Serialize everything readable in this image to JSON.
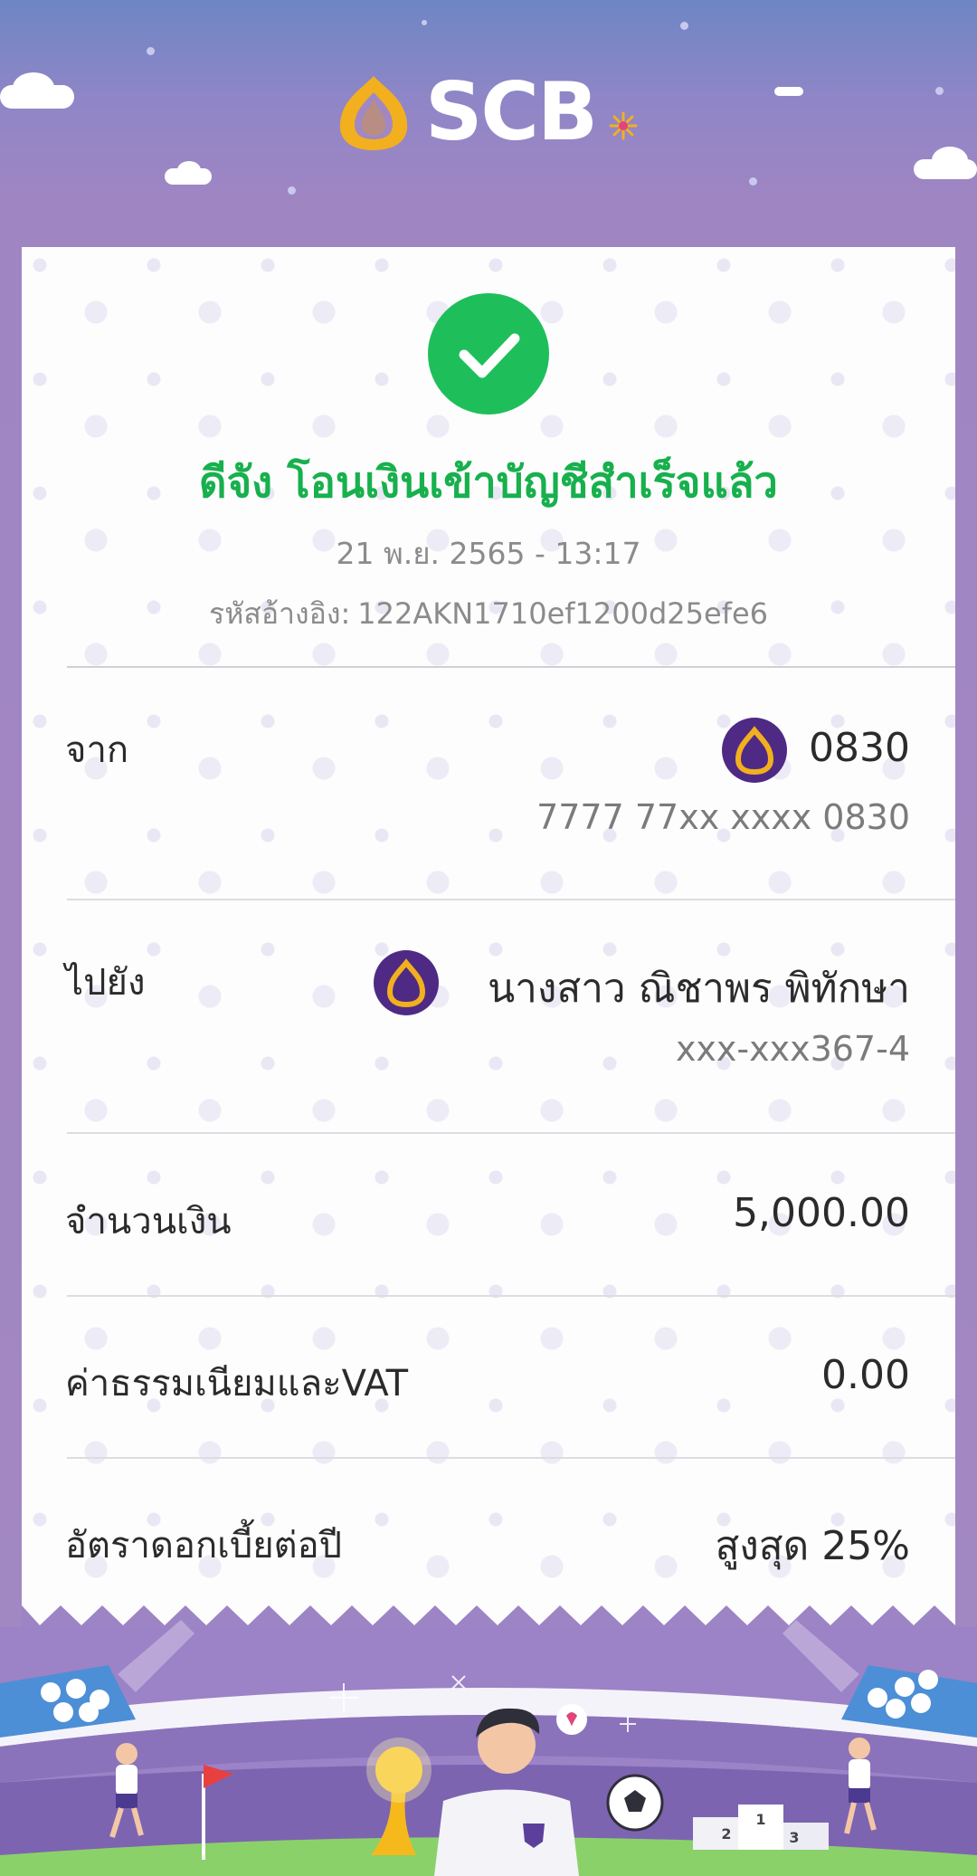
{
  "header": {
    "brand": "SCB",
    "logo_icon": "scb-lotus-icon",
    "colors": {
      "brand_gold": "#f2b01e",
      "brand_purple": "#4e2a84"
    }
  },
  "receipt": {
    "status_icon": "check-circle-icon",
    "status_color": "#1ebf5b",
    "title": "ดีจัง โอนเงินเข้าบัญชีสำเร็จแล้ว",
    "datetime": "21 พ.ย. 2565 - 13:17",
    "ref_label": "รหัสอ้างอิง:",
    "ref_value": "122AKN1710ef1200d25efe6",
    "from": {
      "label": "จาก",
      "account_short": "0830",
      "account_full": "7777 77xx xxxx 0830",
      "bank_icon": "scb-bank-icon"
    },
    "to": {
      "label": "ไปยัง",
      "name": "นางสาว ณิชาพร พิทักษา",
      "account": "xxx-xxx367-4",
      "bank_icon": "scb-bank-icon"
    },
    "amount": {
      "label": "จำนวนเงิน",
      "value": "5,000.00"
    },
    "fee": {
      "label": "ค่าธรรมเนียมและVAT",
      "value": "0.00"
    },
    "interest": {
      "label": "อัตราดอกเบี้ยต่อปี",
      "value": "สูงสุด 25%"
    }
  },
  "footer": {
    "illustration": "football-world-cup-banner",
    "podium_numbers": [
      "2",
      "1",
      "3"
    ]
  }
}
